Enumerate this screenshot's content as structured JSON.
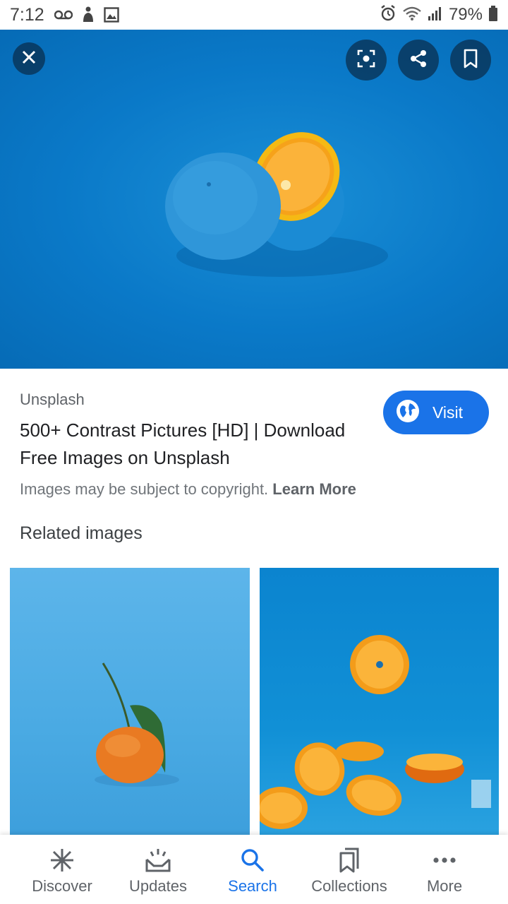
{
  "status_bar": {
    "time": "7:12",
    "battery": "79%"
  },
  "hero": {
    "icons": [
      "close-icon",
      "lens-icon",
      "share-icon",
      "bookmark-icon"
    ]
  },
  "result": {
    "source": "Unsplash",
    "title": "500+ Contrast Pictures [HD] | Download Free Images on Unsplash",
    "visit_label": "Visit",
    "copyright_text": "Images may be subject to copyright.",
    "learn_more": "Learn More"
  },
  "related": {
    "heading": "Related images"
  },
  "bottom_nav": {
    "items": [
      {
        "label": "Discover",
        "icon": "asterisk-icon"
      },
      {
        "label": "Updates",
        "icon": "updates-icon"
      },
      {
        "label": "Search",
        "icon": "search-icon",
        "active": true
      },
      {
        "label": "Collections",
        "icon": "collections-icon"
      },
      {
        "label": "More",
        "icon": "more-dots-icon"
      }
    ]
  },
  "colors": {
    "accent": "#1a73e8",
    "hero_blue": "#0a79c8"
  }
}
